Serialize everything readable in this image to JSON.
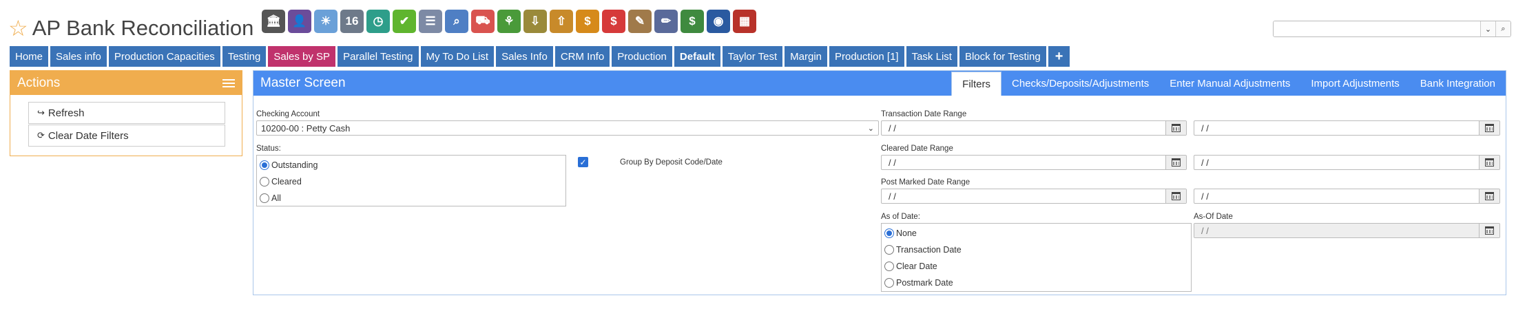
{
  "header": {
    "title": "AP Bank Reconciliation",
    "toolbar_icons": [
      {
        "name": "bank-icon",
        "glyph": "🏛",
        "color": "#555555"
      },
      {
        "name": "user-icon",
        "glyph": "👤",
        "color": "#6b4c9a"
      },
      {
        "name": "weather-icon",
        "glyph": "☀",
        "color": "#6aa0d8"
      },
      {
        "name": "calendar-icon",
        "glyph": "16",
        "color": "#6e7a8a"
      },
      {
        "name": "clock-icon",
        "glyph": "◷",
        "color": "#2e9e8a"
      },
      {
        "name": "checkmark-icon",
        "glyph": "✔",
        "color": "#5fb52e"
      },
      {
        "name": "list-icon",
        "glyph": "☰",
        "color": "#7d8aa5"
      },
      {
        "name": "magnifier-icon",
        "glyph": "⌕",
        "color": "#4f7fc4"
      },
      {
        "name": "truck-icon",
        "glyph": "⛟",
        "color": "#d9534f"
      },
      {
        "name": "basket-icon",
        "glyph": "⚘",
        "color": "#4a9a3a"
      },
      {
        "name": "inbox-icon",
        "glyph": "⇩",
        "color": "#9a8a3a"
      },
      {
        "name": "outbox-icon",
        "glyph": "⇧",
        "color": "#c88a2a"
      },
      {
        "name": "coins-icon",
        "glyph": "$",
        "color": "#d68a1a"
      },
      {
        "name": "chat-dollar-icon",
        "glyph": "$",
        "color": "#d63a3a"
      },
      {
        "name": "clipboard-icon",
        "glyph": "✎",
        "color": "#a07a4a"
      },
      {
        "name": "pencil-icon",
        "glyph": "✏",
        "color": "#5a6a9a"
      },
      {
        "name": "money-icon",
        "glyph": "$",
        "color": "#3f8a3f"
      },
      {
        "name": "globe-icon",
        "glyph": "◉",
        "color": "#2a5aa0"
      },
      {
        "name": "blocks-icon",
        "glyph": "▦",
        "color": "#b8322a"
      }
    ]
  },
  "search": {
    "placeholder": ""
  },
  "nav": [
    {
      "label": "Home",
      "style": ""
    },
    {
      "label": "Sales info",
      "style": ""
    },
    {
      "label": "Production Capacities",
      "style": ""
    },
    {
      "label": "Testing",
      "style": ""
    },
    {
      "label": "Sales by SP",
      "style": "pink"
    },
    {
      "label": "Parallel Testing",
      "style": ""
    },
    {
      "label": "My To Do List",
      "style": ""
    },
    {
      "label": "Sales Info",
      "style": ""
    },
    {
      "label": "CRM Info",
      "style": ""
    },
    {
      "label": "Production",
      "style": ""
    },
    {
      "label": "Default",
      "style": "bold"
    },
    {
      "label": "Taylor Test",
      "style": ""
    },
    {
      "label": "Margin",
      "style": ""
    },
    {
      "label": "Production [1]",
      "style": ""
    },
    {
      "label": "Task List",
      "style": ""
    },
    {
      "label": "Block for Testing",
      "style": ""
    },
    {
      "label": "+",
      "style": "plus"
    }
  ],
  "actions": {
    "title": "Actions",
    "refresh_label": "Refresh",
    "clear_date_filters_label": "Clear Date Filters"
  },
  "master": {
    "title": "Master Screen",
    "tabs": [
      "Filters",
      "Checks/Deposits/Adjustments",
      "Enter Manual Adjustments",
      "Import Adjustments",
      "Bank Integration"
    ],
    "active_tab": "Filters"
  },
  "filters": {
    "checking_account_label": "Checking Account",
    "checking_account_value": "10200-00 : Petty Cash",
    "status_label": "Status:",
    "status_options": [
      "Outstanding",
      "Cleared",
      "All"
    ],
    "status_selected": "Outstanding",
    "group_by_label": "Group By Deposit Code/Date",
    "group_by_checked": true,
    "transaction_date_range_label": "Transaction Date Range",
    "transaction_date_from": " /  /",
    "transaction_date_to": " /  /",
    "cleared_date_range_label": "Cleared Date Range",
    "cleared_date_from": " /  /",
    "cleared_date_to": " /  /",
    "post_marked_date_range_label": "Post Marked Date Range",
    "post_marked_date_from": " /  /",
    "post_marked_date_to": " /  /",
    "as_of_date_label": "As of Date:",
    "as_of_options": [
      "None",
      "Transaction Date",
      "Clear Date",
      "Postmark Date"
    ],
    "as_of_selected": "None",
    "as_of_date_field_label": "As-Of Date",
    "as_of_date_value": " /  /"
  },
  "colors": {
    "nav_blue": "#3a73b7",
    "nav_pink": "#c0326c",
    "actions_orange": "#f0ad4e",
    "master_blue": "#4a8cf0",
    "radio_blue": "#2a6fd6"
  }
}
